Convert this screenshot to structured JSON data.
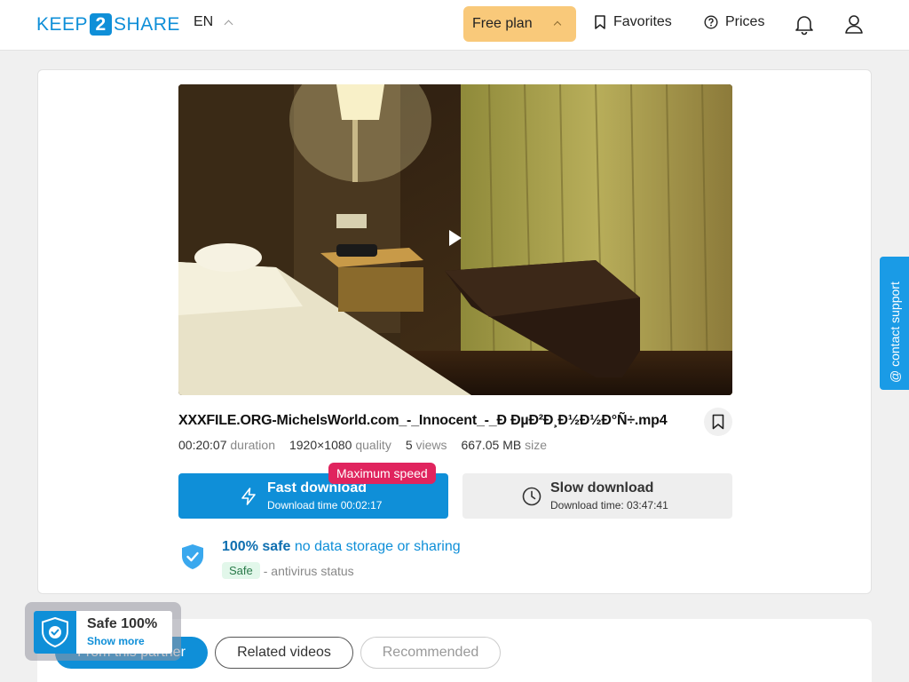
{
  "header": {
    "logo": {
      "left": "KEEP",
      "mid": "2",
      "right": "SHARE"
    },
    "language": "EN",
    "plan_button": "Free plan",
    "favorites": "Favorites",
    "prices": "Prices",
    "icons": [
      "bell-icon",
      "user-icon"
    ]
  },
  "file": {
    "name": "XXXFILE.ORG-MichelsWorld.com_-_Innocent_-_Ð     ÐµÐ²Ð¸Ð½Ð½Ð°Ñ÷.mp4",
    "duration": "00:20:07",
    "duration_label": "duration",
    "quality": "1920×1080",
    "quality_label": "quality",
    "views": "5",
    "views_label": "views",
    "size": "667.05 MB",
    "size_label": "size"
  },
  "download": {
    "badge": "Maximum speed",
    "fast_title": "Fast download",
    "fast_sub": "Download time 00:02:17",
    "slow_title": "Slow download",
    "slow_sub": "Download time: 03:47:41"
  },
  "safety": {
    "bold": "100% safe",
    "text": "no data storage or sharing",
    "tag": "Safe",
    "status": "- antivirus status"
  },
  "tabs": {
    "partner": "From this partner",
    "related": "Related videos",
    "recommended": "Recommended"
  },
  "badge": {
    "title": "Safe 100%",
    "link": "Show more"
  },
  "support": "contact support",
  "colors": {
    "accent": "#0f8fd8",
    "plan": "#f9c97a",
    "max_speed": "#e0245e"
  }
}
